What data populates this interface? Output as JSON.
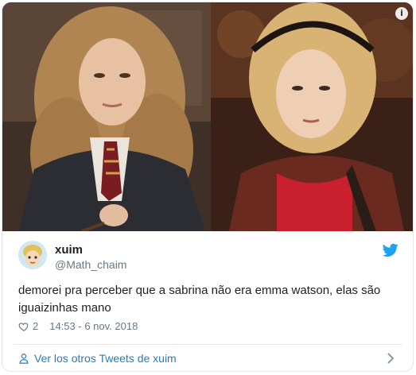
{
  "tweet": {
    "author_name": "xuim",
    "author_handle": "@Math_chaim",
    "text": "demorei pra perceber que a sabrina não era emma watson, elas são iguaizinhas mano",
    "like_count": "2",
    "timestamp": "14:53 - 6 nov. 2018",
    "more_tweets_label": "Ver los otros Tweets de xuim",
    "info_symbol": "i"
  },
  "icons": {
    "info": "info-icon",
    "bird": "twitter-bird-icon",
    "like": "heart-icon",
    "more": "person-icon",
    "chevron": "chevron-right-icon"
  },
  "colors": {
    "link": "#2b7bb9",
    "secondary_text": "#697882",
    "brand": "#1da1f2",
    "border": "#e1e8ed"
  }
}
